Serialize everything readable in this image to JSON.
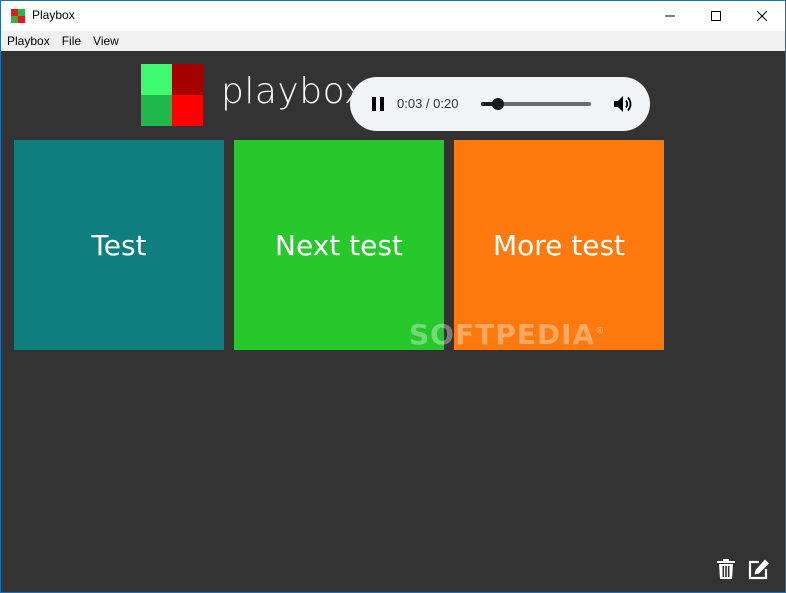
{
  "window": {
    "title": "Playbox",
    "icon_colors": [
      "#e31b1b",
      "#2fb34a",
      "#2fb34a",
      "#e31b1b"
    ]
  },
  "menu": {
    "items": [
      "Playbox",
      "File",
      "View"
    ]
  },
  "logo": {
    "text": "playbox",
    "colors": {
      "top_left": "#3dfa6e",
      "top_right": "#a70000",
      "bottom_left": "#1fb84b",
      "bottom_right": "#ff0000"
    }
  },
  "player": {
    "state": "playing",
    "current_time": "0:03",
    "duration": "0:20",
    "time_display": "0:03 / 0:20",
    "progress_fraction": 0.15
  },
  "tiles": [
    {
      "label": "Test",
      "color": "#0e7f7e"
    },
    {
      "label": "Next test",
      "color": "#27c82b"
    },
    {
      "label": "More test",
      "color": "#ff7a0e"
    }
  ],
  "watermark": {
    "text": "SOFTPEDIA",
    "mark": "®"
  },
  "icons": {
    "delete": "trash-icon",
    "edit": "edit-icon"
  }
}
